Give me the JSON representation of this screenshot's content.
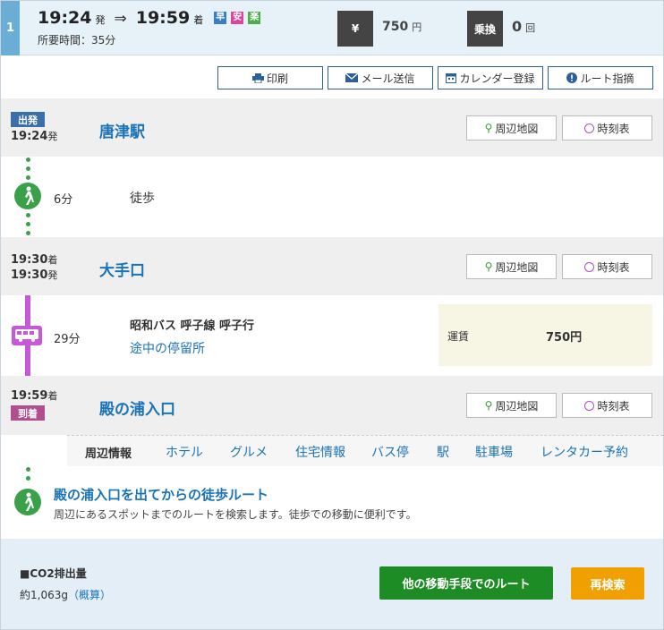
{
  "route": {
    "number": "1",
    "depart_time": "19:24",
    "depart_suffix": "発",
    "arrow": "⇒",
    "arrive_time": "19:59",
    "arrive_suffix": "着",
    "tags": [
      {
        "label": "早",
        "color": "#3a7fc1"
      },
      {
        "label": "安",
        "color": "#e0449a"
      },
      {
        "label": "楽",
        "color": "#4cae4c"
      }
    ],
    "duration": "所要時間：35分",
    "fare_icon": "¥",
    "fare_value": "750",
    "fare_unit": "円",
    "transfer_label": "乗換",
    "transfer_value": "0",
    "transfer_unit": "回"
  },
  "toolbar": {
    "print": "印刷",
    "mail": "メール送信",
    "calendar": "カレンダー登録",
    "route_point": "ルート指摘"
  },
  "stops": [
    {
      "badge": "出発",
      "time1": "19:24",
      "suffix1": "発",
      "name": "唐津駅"
    },
    {
      "time1": "19:30",
      "suffix1": "着",
      "time2": "19:30",
      "suffix2": "発",
      "name": "大手口"
    },
    {
      "time1": "19:59",
      "suffix1": "着",
      "badge": "到着",
      "name": "殿の浦入口"
    }
  ],
  "stop_buttons": {
    "map": "周辺地図",
    "timetable": "時刻表"
  },
  "legs": {
    "walk": {
      "minutes": "6分",
      "mode": "徒歩"
    },
    "bus": {
      "minutes": "29分",
      "line": "昭和バス 呼子線 呼子行",
      "stops_link": "途中の停留所",
      "fare_label": "運賃",
      "fare_value": "750円"
    }
  },
  "nearby": {
    "title": "周辺情報",
    "links": [
      "ホテル",
      "グルメ",
      "住宅情報",
      "バス停",
      "駅",
      "駐車場",
      "レンタカー予約"
    ]
  },
  "walk_route": {
    "title": "殿の浦入口を出てからの徒歩ルート",
    "desc": "周辺にあるスポットまでのルートを検索します。徒歩での移動に便利です。"
  },
  "footer": {
    "co2_label": "■CO2排出量",
    "co2_value": "約1,063g",
    "co2_link": "（概算）",
    "other_route": "他の移動手段でのルート",
    "research": "再検索"
  }
}
